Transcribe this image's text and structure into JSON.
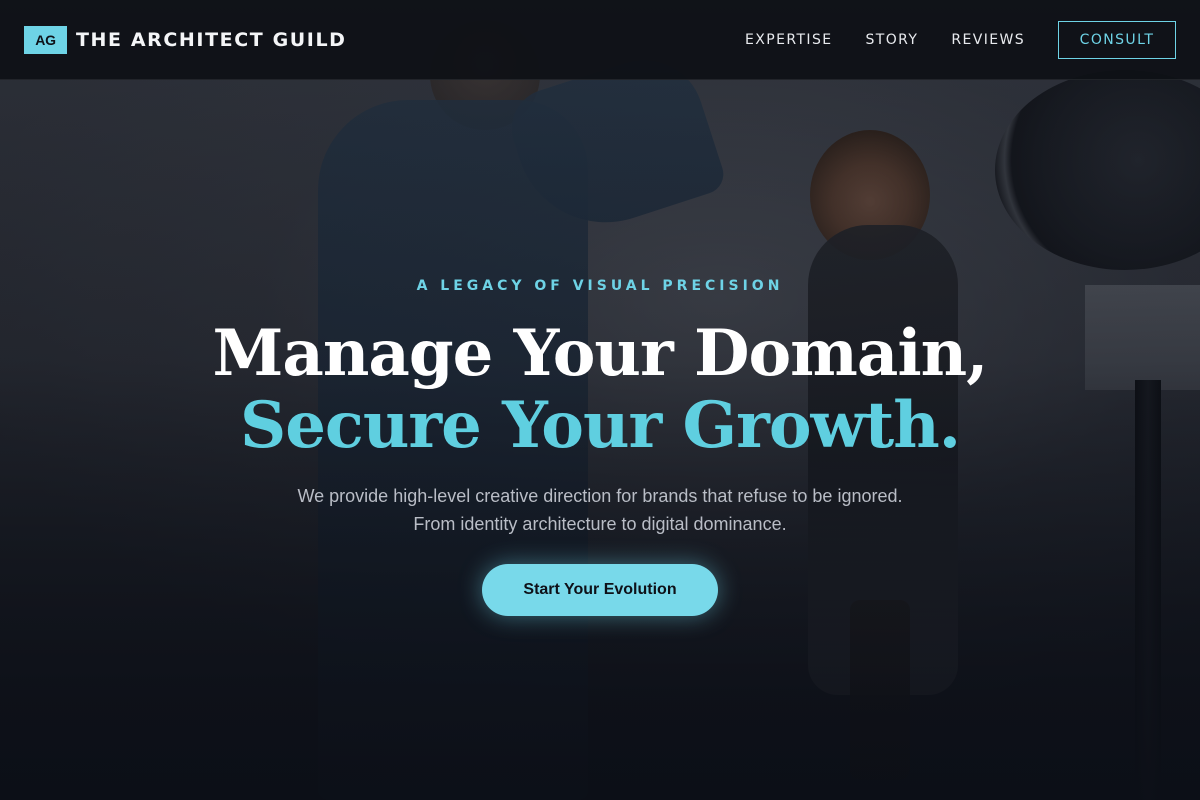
{
  "header": {
    "logo_badge": "AG",
    "brand_name": "THE ARCHITECT GUILD",
    "nav": [
      {
        "label": "EXPERTISE"
      },
      {
        "label": "STORY"
      },
      {
        "label": "REVIEWS"
      }
    ],
    "cta_label": "CONSULT"
  },
  "hero": {
    "eyebrow": "A LEGACY OF VISUAL PRECISION",
    "headline_line1": "Manage Your Domain,",
    "headline_line2": "Secure Your Growth.",
    "subtext_line1": "We provide high-level creative direction for brands that refuse to be ignored.",
    "subtext_line2": "From identity architecture to digital dominance.",
    "cta_label": "Start Your Evolution"
  },
  "colors": {
    "accent": "#6ed3e6",
    "background": "#0c0f17",
    "headline": "#ffffff",
    "body_text": "#b9bdc6"
  }
}
